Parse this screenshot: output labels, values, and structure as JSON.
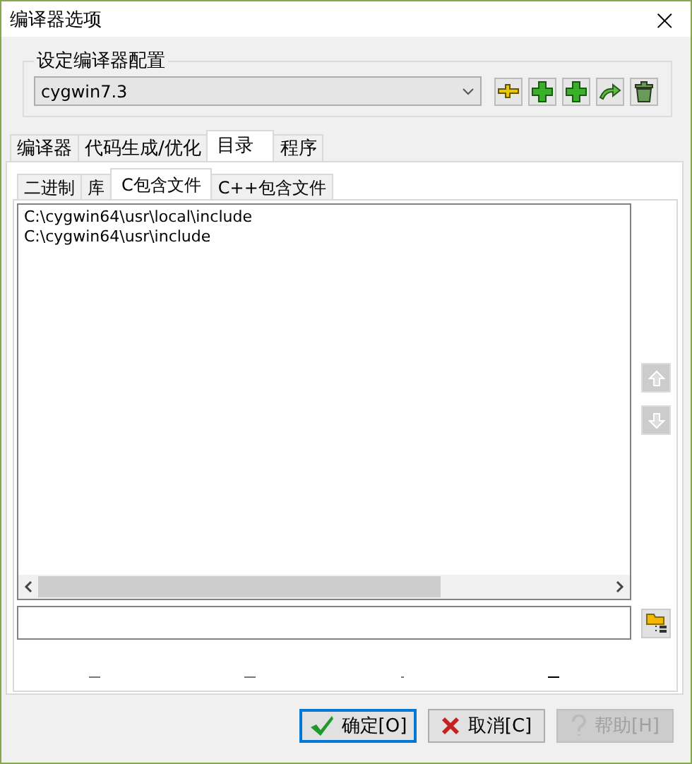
{
  "window": {
    "title": "编译器选项",
    "close": "×"
  },
  "config_group": {
    "label": "设定编译器配置",
    "value": "cygwin7.3",
    "tools": [
      {
        "kind": "rename"
      },
      {
        "kind": "add"
      },
      {
        "kind": "add"
      },
      {
        "kind": "export"
      },
      {
        "kind": "delete"
      }
    ]
  },
  "tabs": [
    {
      "label": "编译器",
      "selected": false
    },
    {
      "label": "代码生成/优化",
      "selected": false
    },
    {
      "label": "目录",
      "selected": true
    },
    {
      "label": "程序",
      "selected": false
    }
  ],
  "subtabs": [
    {
      "label": "二进制",
      "selected": false
    },
    {
      "label": "库",
      "selected": false
    },
    {
      "label": "C包含文件",
      "selected": true
    },
    {
      "label": "C++包含文件",
      "selected": false
    }
  ],
  "paths": [
    {
      "text": "C:\\cygwin64\\usr\\local\\include"
    },
    {
      "text": "C:\\cygwin64\\usr\\include"
    }
  ],
  "buttons": [
    {
      "kind": "ok",
      "label": "确定[O]",
      "disabled": false,
      "focused": true
    },
    {
      "kind": "cancel",
      "label": "取消[C]",
      "disabled": false,
      "focused": false
    },
    {
      "kind": "help",
      "label": "帮助[H]",
      "disabled": true,
      "focused": false
    }
  ]
}
